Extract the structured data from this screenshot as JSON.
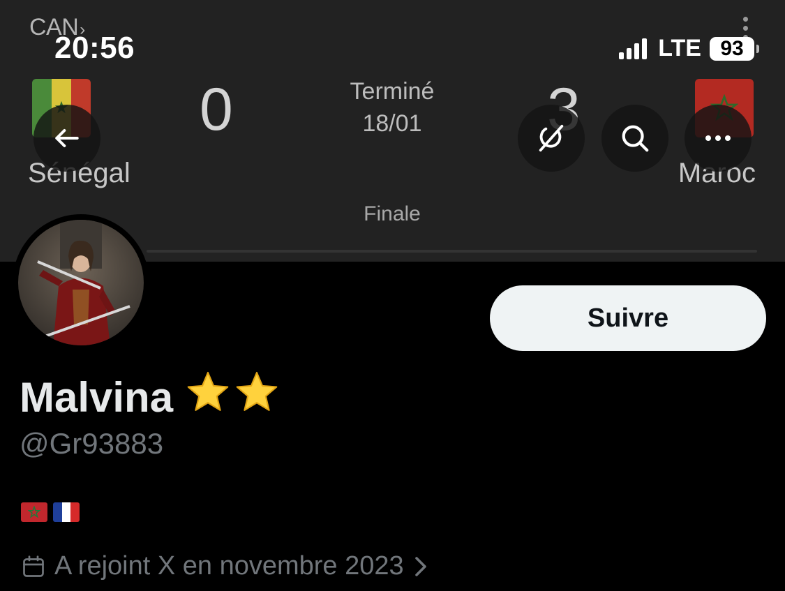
{
  "status_bar": {
    "time": "20:56",
    "network": "LTE",
    "battery": "93"
  },
  "banner": {
    "league": "CAN",
    "home_team": "Sénégal",
    "away_team": "Maroc",
    "home_score": "0",
    "away_score": "3",
    "status": "Terminé",
    "date": "18/01",
    "stage": "Finale"
  },
  "nav": {
    "back_icon": "arrow-left-icon",
    "grok_icon": "grok-icon",
    "search_icon": "search-icon",
    "more_icon": "more-horizontal-icon"
  },
  "profile": {
    "display_name": "Malvina",
    "name_badges": [
      "star-emoji",
      "star-emoji"
    ],
    "handle": "@Gr93883",
    "bio_emojis": [
      "flag-morocco",
      "flag-france"
    ],
    "joined": "A rejoint X en novembre 2023",
    "follow_label": "Suivre"
  },
  "colors": {
    "background": "#000000",
    "banner": "#222222",
    "follow_button_bg": "#eff3f4",
    "secondary_text": "#71767b"
  }
}
